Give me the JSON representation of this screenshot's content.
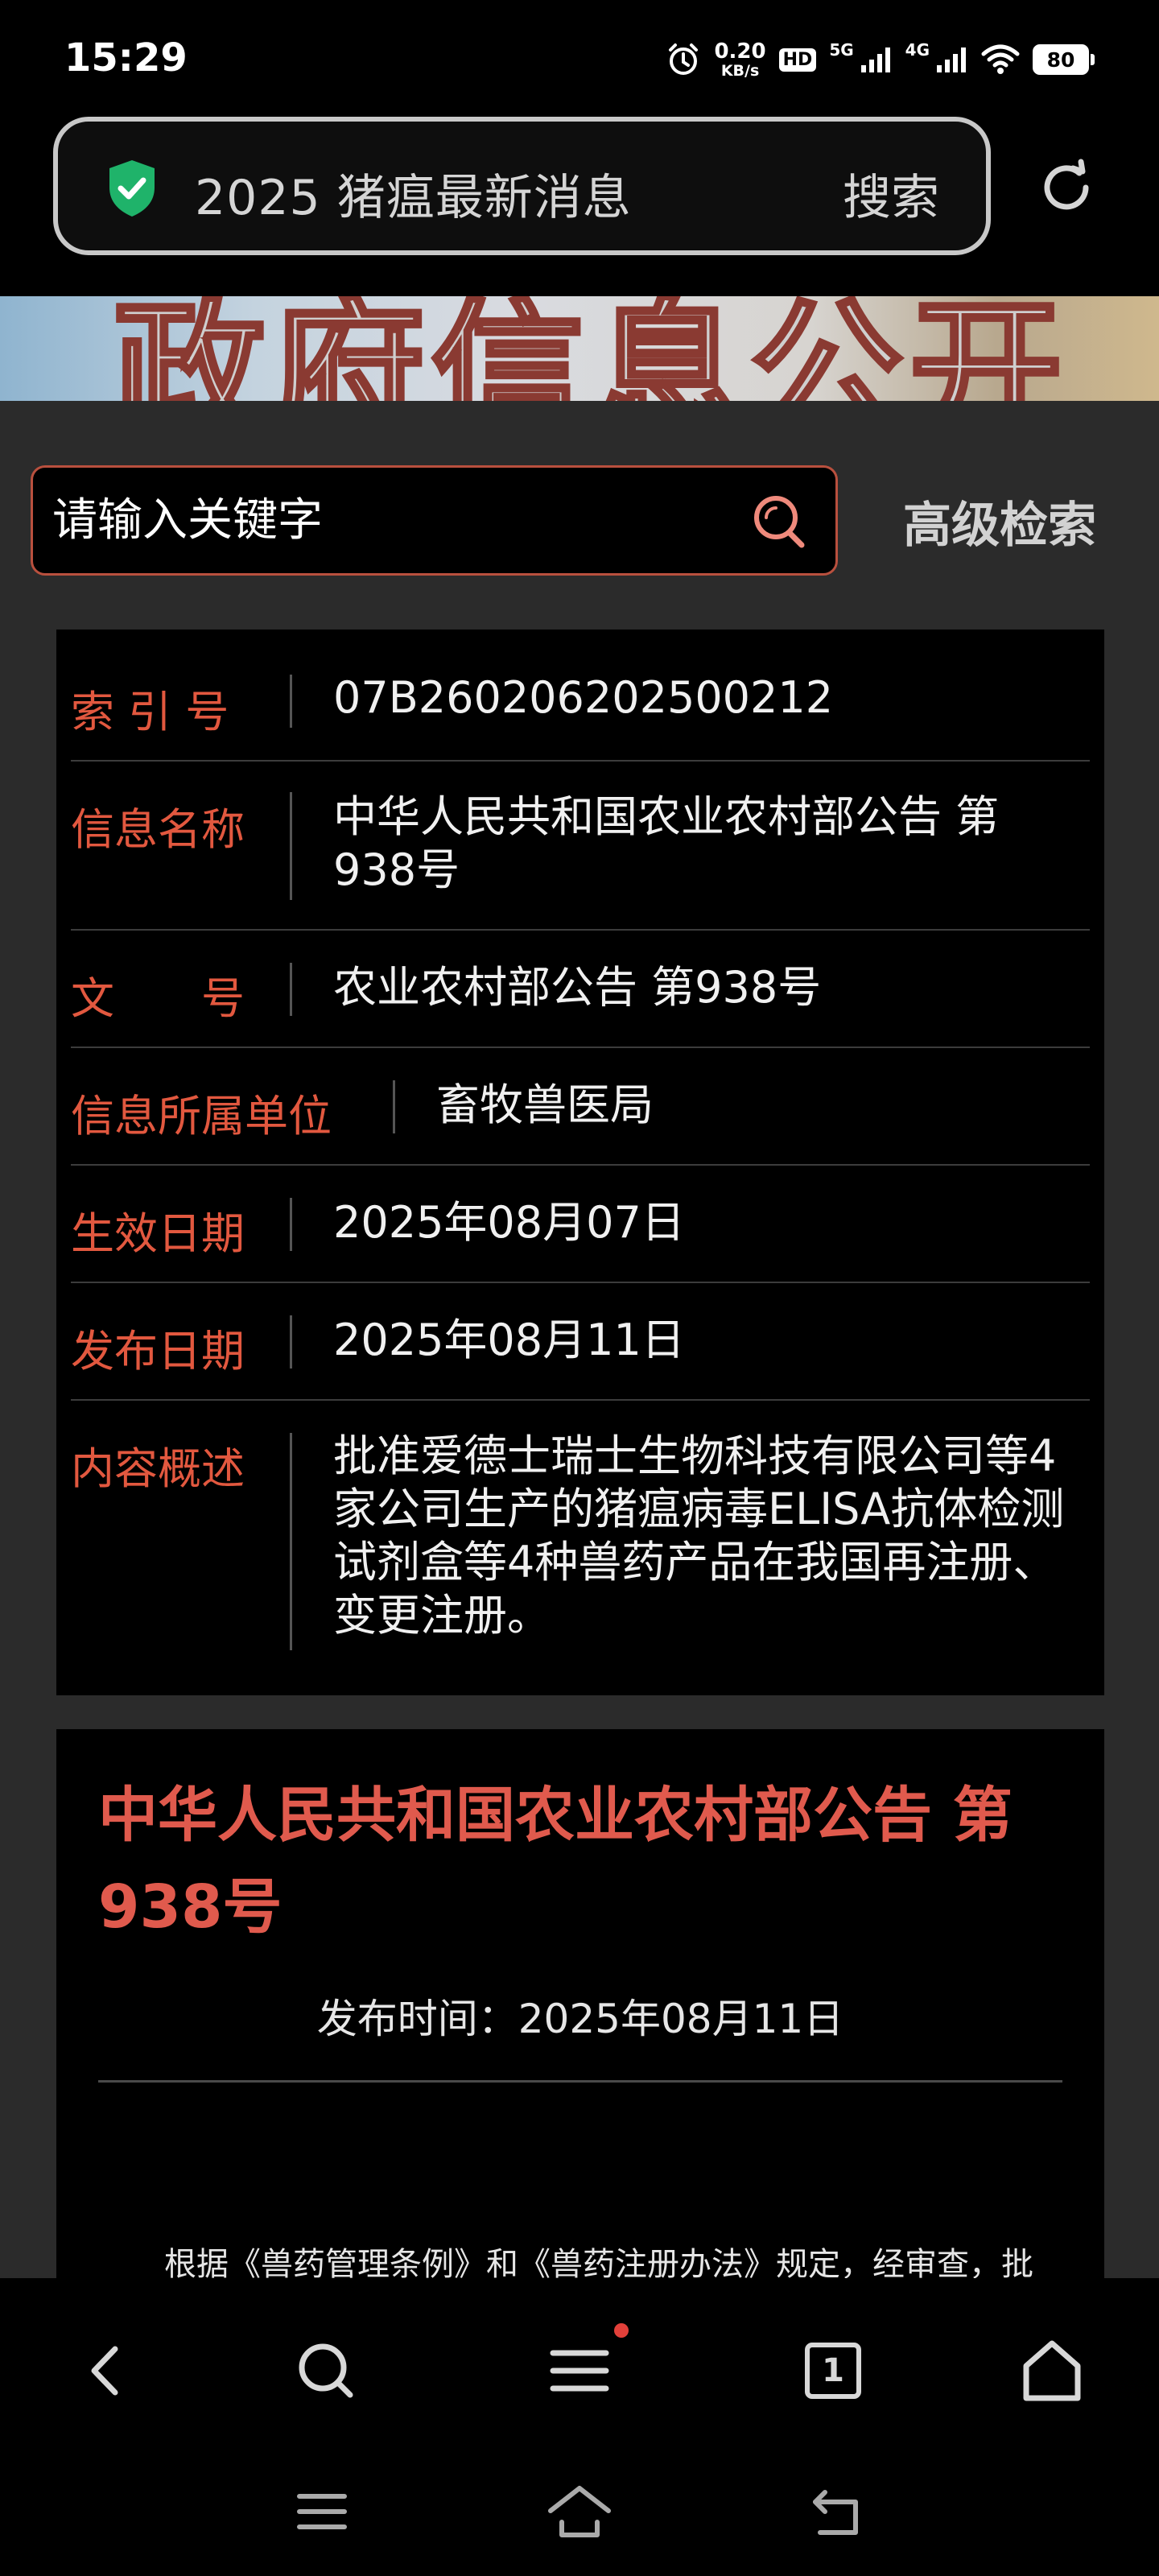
{
  "status_bar": {
    "time": "15:29",
    "net_speed_value": "0.20",
    "net_speed_unit": "KB/s",
    "hd_badge": "HD",
    "sig1_label": "5G",
    "sig2_label": "4G",
    "battery": "80",
    "icons": [
      "alarm-icon",
      "hd-icon",
      "signal-5g-icon",
      "signal-4g-icon",
      "wifi-icon",
      "battery-icon"
    ]
  },
  "address_bar": {
    "query": "2025 猪瘟最新消息",
    "search_label": "搜索",
    "icons": [
      "shield-check-icon",
      "refresh-icon"
    ],
    "shield_color": "#1fb36a"
  },
  "banner": {
    "text": "政府信息公开"
  },
  "search": {
    "placeholder": "请输入关键字",
    "advanced_label": "高级检索"
  },
  "info_table": [
    {
      "label": "索 引 号",
      "value": "07B260206202500212"
    },
    {
      "label": "信息名称",
      "value": "中华人民共和国农业农村部公告 第938号"
    },
    {
      "label": "文　　号",
      "value": "农业农村部公告 第938号"
    },
    {
      "label": "信息所属单位",
      "value": "畜牧兽医局"
    },
    {
      "label": "生效日期",
      "value": "2025年08月07日"
    },
    {
      "label": "发布日期",
      "value": "2025年08月11日"
    },
    {
      "label": "内容概述",
      "value": "批准爱德士瑞士生物科技有限公司等4家公司生产的猪瘟病毒ELISA抗体检测试剂盒等4种兽药产品在我国再注册、变更注册。"
    }
  ],
  "article": {
    "title": "中华人民共和国农业农村部公告 第938号",
    "publish_time": "发布时间：2025年08月11日",
    "body_first_line": "根据《兽药管理条例》和《兽药注册办法》规定，经审查，批"
  },
  "toolbar": {
    "tab_count": "1",
    "icons": [
      "back-icon",
      "search-icon",
      "menu-icon",
      "tabs-icon",
      "home-icon"
    ]
  },
  "colors": {
    "accent_red": "#e2583f",
    "title_red": "#e05a4d",
    "page_bg": "#2b2b2b"
  }
}
